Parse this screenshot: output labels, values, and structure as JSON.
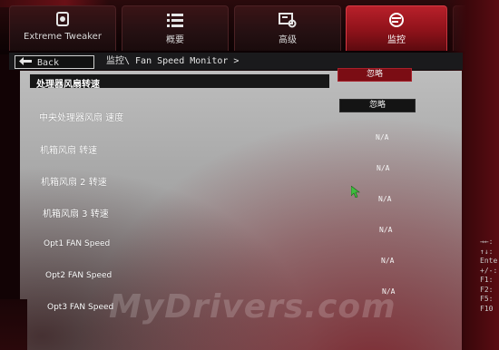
{
  "tabs": [
    {
      "label": "Extreme Tweaker",
      "icon": "tweaker-icon"
    },
    {
      "label": "概要",
      "icon": "list-icon"
    },
    {
      "label": "高级",
      "icon": "advanced-icon"
    },
    {
      "label": "监控",
      "icon": "monitor-icon",
      "active": true
    }
  ],
  "nav": {
    "back_label": "Back",
    "breadcrumb": "监控\\ Fan Speed Monitor >"
  },
  "rows": [
    {
      "label": "处理器风扇转速",
      "value": "忽略",
      "selected": true
    },
    {
      "label": "中央处理器风扇 速度",
      "value": "忽略"
    },
    {
      "label": "机箱风扇 转速",
      "value": "N/A"
    },
    {
      "label": "机箱风扇 2 转速",
      "value": "N/A"
    },
    {
      "label": "机箱风扇 3 转速",
      "value": "N/A"
    },
    {
      "label": "Opt1 FAN Speed",
      "value": "N/A"
    },
    {
      "label": "Opt2 FAN Speed",
      "value": "N/A"
    },
    {
      "label": "Opt3 FAN Speed",
      "value": "N/A"
    }
  ],
  "help_keys": [
    "→←:",
    "↑↓:",
    "Ente",
    "+/-:",
    "F1:",
    "F2:",
    "F5:",
    "F10"
  ],
  "watermark": "MyDrivers.com",
  "colors": {
    "accent": "#b8202a",
    "selection": "#171717",
    "panel": "#a9a9a9"
  }
}
